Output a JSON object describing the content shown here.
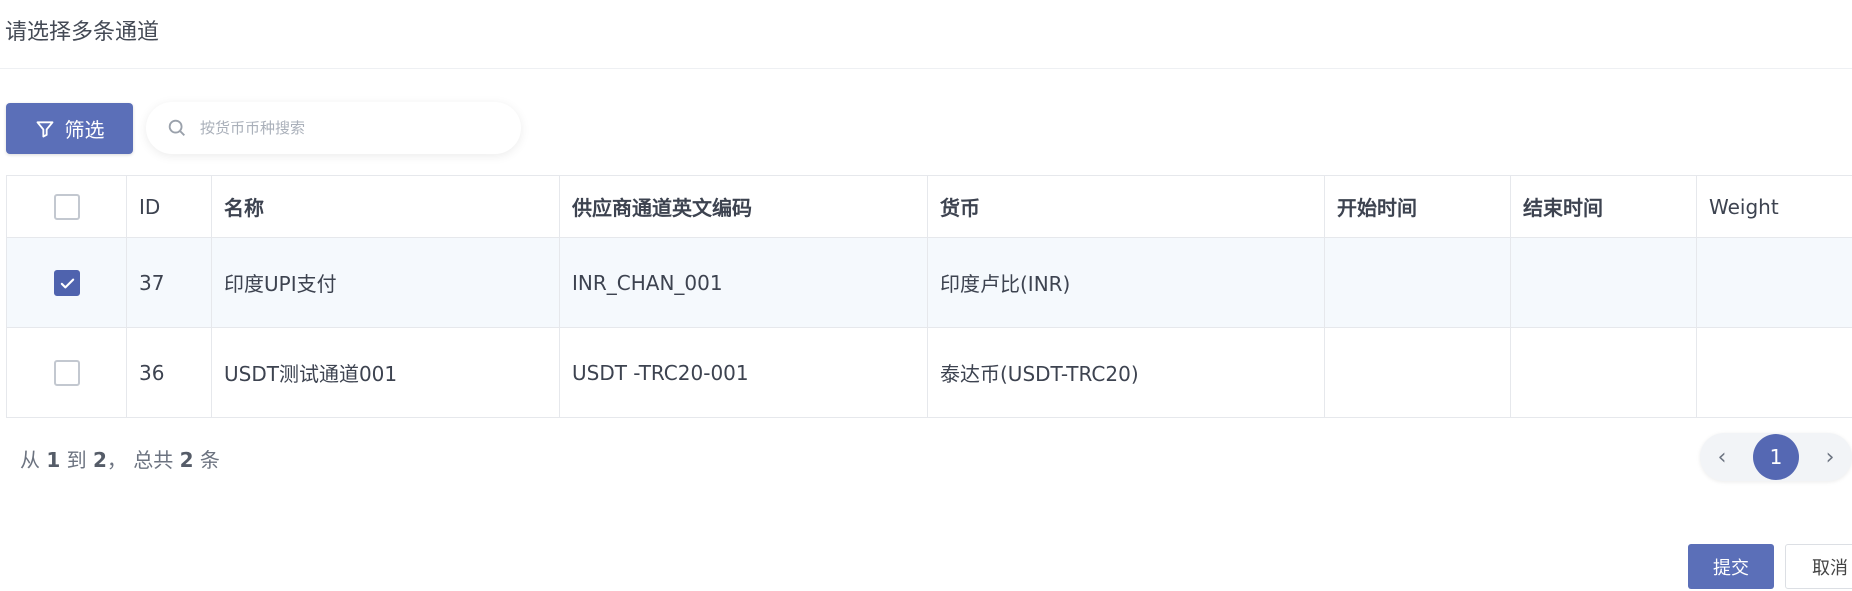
{
  "dialog": {
    "title": "请选择多条通道"
  },
  "toolbar": {
    "filter_label": "筛选",
    "search_placeholder": "按货币币种搜索"
  },
  "table": {
    "headers": [
      "ID",
      "名称",
      "供应商通道英文编码",
      "货币",
      "开始时间",
      "结束时间",
      "Weight"
    ],
    "rows": [
      {
        "checked": true,
        "id": "37",
        "name": "印度UPI支付",
        "code": "INR_CHAN_001",
        "currency": "印度卢比(INR)",
        "start": "",
        "end": "",
        "weight": ""
      },
      {
        "checked": false,
        "id": "36",
        "name": "USDT测试通道001",
        "code": "USDT -TRC20-001",
        "currency": "泰达币(USDT-TRC20)",
        "start": "",
        "end": "",
        "weight": ""
      }
    ]
  },
  "summary": {
    "prefix": "从",
    "from": "1",
    "to_label": "到",
    "to": "2",
    "total_label": "，  总共",
    "total": "2",
    "suffix": "条"
  },
  "pagination": {
    "current_page": "1",
    "prev_icon": "chevron-left",
    "next_icon": "chevron-right"
  },
  "footer": {
    "submit_label": "提交",
    "cancel_label": "取消"
  },
  "colors": {
    "primary": "#5b6fb8",
    "selected_row": "#f5f9fd",
    "border": "#e6e8ec"
  }
}
